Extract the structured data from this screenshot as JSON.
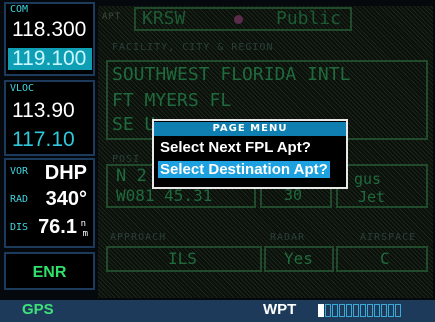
{
  "com": {
    "tag": "COM",
    "active": "118.300",
    "standby": "119.100"
  },
  "vloc": {
    "tag": "VLOC",
    "active": "113.90",
    "standby": "117.10"
  },
  "vor": {
    "tag": "VOR",
    "ident": "DHP",
    "rad_tag": "RAD",
    "radial": "340°",
    "dis_tag": "DIS",
    "distance": "76.1",
    "unit_top": "n",
    "unit_bot": "m"
  },
  "mode": {
    "label": "ENR"
  },
  "header": {
    "apt_tag": "APT",
    "ident": "KRSW",
    "type": "Public"
  },
  "facility": {
    "label": "FACILITY, CITY & REGION",
    "name": "SOUTHWEST FLORIDA INTL",
    "city": "FT MYERS FL",
    "region": "SE U"
  },
  "position": {
    "label": "POSI",
    "lat": "N 2",
    "lon": "W081 45.31",
    "elev": "30",
    "fuel_1": "gus",
    "fuel_2": "Jet"
  },
  "info": {
    "approach_label": "APPROACH",
    "approach": "ILS",
    "radar_label": "RADAR",
    "radar": "Yes",
    "airspace_label": "AIRSPACE",
    "airspace": "C"
  },
  "page_menu": {
    "title": "PAGE MENU",
    "items": [
      "Select Next FPL Apt?",
      "Select Destination Apt?"
    ],
    "selected_index": 1
  },
  "bottom": {
    "nav_source": "GPS",
    "page_group": "WPT",
    "page_count": 12,
    "current_page": 1
  },
  "colors": {
    "cyan": "#0e9fb4",
    "green": "#2fe06a",
    "highlight": "#1da1e0"
  }
}
